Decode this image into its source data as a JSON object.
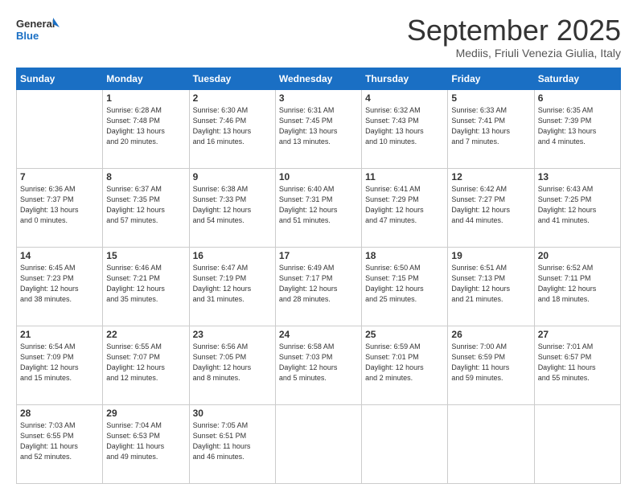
{
  "header": {
    "logo_general": "General",
    "logo_blue": "Blue",
    "month": "September 2025",
    "location": "Mediis, Friuli Venezia Giulia, Italy"
  },
  "days_of_week": [
    "Sunday",
    "Monday",
    "Tuesday",
    "Wednesday",
    "Thursday",
    "Friday",
    "Saturday"
  ],
  "weeks": [
    [
      {
        "day": "",
        "info": ""
      },
      {
        "day": "1",
        "info": "Sunrise: 6:28 AM\nSunset: 7:48 PM\nDaylight: 13 hours\nand 20 minutes."
      },
      {
        "day": "2",
        "info": "Sunrise: 6:30 AM\nSunset: 7:46 PM\nDaylight: 13 hours\nand 16 minutes."
      },
      {
        "day": "3",
        "info": "Sunrise: 6:31 AM\nSunset: 7:45 PM\nDaylight: 13 hours\nand 13 minutes."
      },
      {
        "day": "4",
        "info": "Sunrise: 6:32 AM\nSunset: 7:43 PM\nDaylight: 13 hours\nand 10 minutes."
      },
      {
        "day": "5",
        "info": "Sunrise: 6:33 AM\nSunset: 7:41 PM\nDaylight: 13 hours\nand 7 minutes."
      },
      {
        "day": "6",
        "info": "Sunrise: 6:35 AM\nSunset: 7:39 PM\nDaylight: 13 hours\nand 4 minutes."
      }
    ],
    [
      {
        "day": "7",
        "info": "Sunrise: 6:36 AM\nSunset: 7:37 PM\nDaylight: 13 hours\nand 0 minutes."
      },
      {
        "day": "8",
        "info": "Sunrise: 6:37 AM\nSunset: 7:35 PM\nDaylight: 12 hours\nand 57 minutes."
      },
      {
        "day": "9",
        "info": "Sunrise: 6:38 AM\nSunset: 7:33 PM\nDaylight: 12 hours\nand 54 minutes."
      },
      {
        "day": "10",
        "info": "Sunrise: 6:40 AM\nSunset: 7:31 PM\nDaylight: 12 hours\nand 51 minutes."
      },
      {
        "day": "11",
        "info": "Sunrise: 6:41 AM\nSunset: 7:29 PM\nDaylight: 12 hours\nand 47 minutes."
      },
      {
        "day": "12",
        "info": "Sunrise: 6:42 AM\nSunset: 7:27 PM\nDaylight: 12 hours\nand 44 minutes."
      },
      {
        "day": "13",
        "info": "Sunrise: 6:43 AM\nSunset: 7:25 PM\nDaylight: 12 hours\nand 41 minutes."
      }
    ],
    [
      {
        "day": "14",
        "info": "Sunrise: 6:45 AM\nSunset: 7:23 PM\nDaylight: 12 hours\nand 38 minutes."
      },
      {
        "day": "15",
        "info": "Sunrise: 6:46 AM\nSunset: 7:21 PM\nDaylight: 12 hours\nand 35 minutes."
      },
      {
        "day": "16",
        "info": "Sunrise: 6:47 AM\nSunset: 7:19 PM\nDaylight: 12 hours\nand 31 minutes."
      },
      {
        "day": "17",
        "info": "Sunrise: 6:49 AM\nSunset: 7:17 PM\nDaylight: 12 hours\nand 28 minutes."
      },
      {
        "day": "18",
        "info": "Sunrise: 6:50 AM\nSunset: 7:15 PM\nDaylight: 12 hours\nand 25 minutes."
      },
      {
        "day": "19",
        "info": "Sunrise: 6:51 AM\nSunset: 7:13 PM\nDaylight: 12 hours\nand 21 minutes."
      },
      {
        "day": "20",
        "info": "Sunrise: 6:52 AM\nSunset: 7:11 PM\nDaylight: 12 hours\nand 18 minutes."
      }
    ],
    [
      {
        "day": "21",
        "info": "Sunrise: 6:54 AM\nSunset: 7:09 PM\nDaylight: 12 hours\nand 15 minutes."
      },
      {
        "day": "22",
        "info": "Sunrise: 6:55 AM\nSunset: 7:07 PM\nDaylight: 12 hours\nand 12 minutes."
      },
      {
        "day": "23",
        "info": "Sunrise: 6:56 AM\nSunset: 7:05 PM\nDaylight: 12 hours\nand 8 minutes."
      },
      {
        "day": "24",
        "info": "Sunrise: 6:58 AM\nSunset: 7:03 PM\nDaylight: 12 hours\nand 5 minutes."
      },
      {
        "day": "25",
        "info": "Sunrise: 6:59 AM\nSunset: 7:01 PM\nDaylight: 12 hours\nand 2 minutes."
      },
      {
        "day": "26",
        "info": "Sunrise: 7:00 AM\nSunset: 6:59 PM\nDaylight: 11 hours\nand 59 minutes."
      },
      {
        "day": "27",
        "info": "Sunrise: 7:01 AM\nSunset: 6:57 PM\nDaylight: 11 hours\nand 55 minutes."
      }
    ],
    [
      {
        "day": "28",
        "info": "Sunrise: 7:03 AM\nSunset: 6:55 PM\nDaylight: 11 hours\nand 52 minutes."
      },
      {
        "day": "29",
        "info": "Sunrise: 7:04 AM\nSunset: 6:53 PM\nDaylight: 11 hours\nand 49 minutes."
      },
      {
        "day": "30",
        "info": "Sunrise: 7:05 AM\nSunset: 6:51 PM\nDaylight: 11 hours\nand 46 minutes."
      },
      {
        "day": "",
        "info": ""
      },
      {
        "day": "",
        "info": ""
      },
      {
        "day": "",
        "info": ""
      },
      {
        "day": "",
        "info": ""
      }
    ]
  ]
}
